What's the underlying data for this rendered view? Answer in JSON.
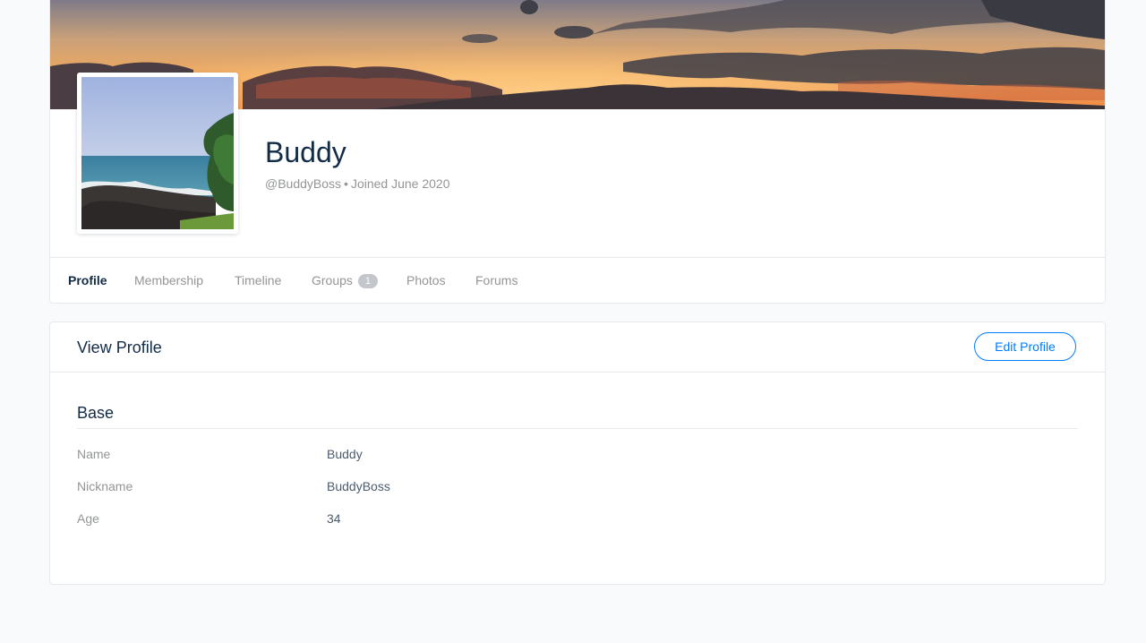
{
  "member": {
    "name": "Buddy",
    "handle": "@BuddyBoss",
    "separator": "•",
    "joined": "Joined June 2020"
  },
  "nav": {
    "items": [
      {
        "label": "Profile",
        "active": true
      },
      {
        "label": "Membership"
      },
      {
        "label": "Timeline"
      },
      {
        "label": "Groups",
        "count": "1"
      },
      {
        "label": "Photos"
      },
      {
        "label": "Forums"
      }
    ]
  },
  "profile_card": {
    "title": "View Profile",
    "edit_label": "Edit Profile",
    "group_title": "Base",
    "fields": [
      {
        "label": "Name",
        "value": "Buddy"
      },
      {
        "label": "Nickname",
        "value": "BuddyBoss"
      },
      {
        "label": "Age",
        "value": "34"
      }
    ]
  },
  "colors": {
    "accent": "#007cff",
    "active_underline": "#385dff",
    "heading": "#122b46",
    "muted": "#939597",
    "page_background": "#f9fafc",
    "border": "#e7e9ec"
  }
}
